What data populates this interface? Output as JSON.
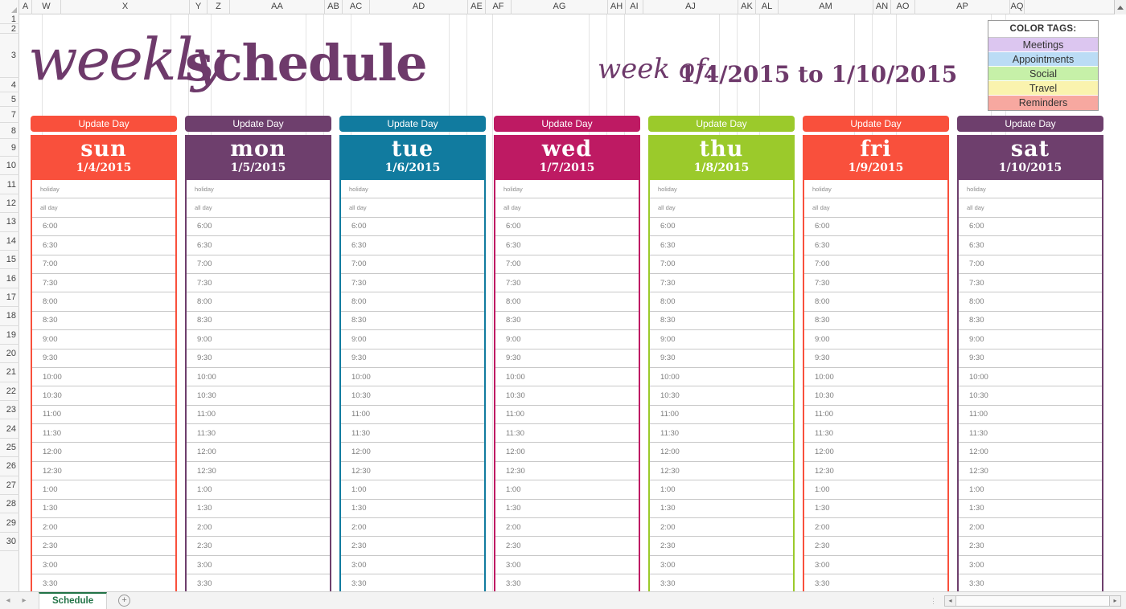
{
  "spreadsheet": {
    "column_headers": [
      "A",
      "W",
      "X",
      "Y",
      "Z",
      "AA",
      "AB",
      "AC",
      "AD",
      "AE",
      "AF",
      "AG",
      "AH",
      "AI",
      "AJ",
      "AK",
      "AL",
      "AM",
      "AN",
      "AO",
      "AP",
      "AQ"
    ],
    "row_headers": [
      "1",
      "2",
      "3",
      "4",
      "5",
      "7",
      "8",
      "9",
      "10",
      "11",
      "12",
      "13",
      "14",
      "15",
      "16",
      "17",
      "18",
      "19",
      "20",
      "21",
      "22",
      "23",
      "24",
      "25",
      "26",
      "27",
      "28",
      "29",
      "30"
    ],
    "sheet_tab": "Schedule",
    "add_sheet_label": "+",
    "nav_prev": "◂",
    "nav_next": "▸",
    "scroll_left": "◂",
    "scroll_right": "▸",
    "scroll_up": "▴"
  },
  "banner": {
    "title_script": "weekly",
    "title_bold": "schedule",
    "weekof_label": "week of:",
    "weekof_value": "1/4/2015 to 1/10/2015",
    "brand_purple": "#6E3A6B"
  },
  "legend": {
    "title": "COLOR TAGS:",
    "items": [
      {
        "label": "Meetings",
        "color": "#DCC6F0"
      },
      {
        "label": "Appointments",
        "color": "#BBDCF5"
      },
      {
        "label": "Social",
        "color": "#C6F0A8"
      },
      {
        "label": "Travel",
        "color": "#FAF3AE"
      },
      {
        "label": "Reminders",
        "color": "#F7A8A0"
      }
    ]
  },
  "schedule": {
    "update_day_label": "Update Day",
    "meta_rows": [
      "holiday",
      "all day"
    ],
    "time_slots": [
      "6:00",
      "6:30",
      "7:00",
      "7:30",
      "8:00",
      "8:30",
      "9:00",
      "9:30",
      "10:00",
      "10:30",
      "11:00",
      "11:30",
      "12:00",
      "12:30",
      "1:00",
      "1:30",
      "2:00",
      "2:30",
      "3:00",
      "3:30"
    ],
    "days": [
      {
        "name": "sun",
        "date": "1/4/2015",
        "color": "#F9503C"
      },
      {
        "name": "mon",
        "date": "1/5/2015",
        "color": "#6E3F6D"
      },
      {
        "name": "tue",
        "date": "1/6/2015",
        "color": "#117B9F"
      },
      {
        "name": "wed",
        "date": "1/7/2015",
        "color": "#BE1A63"
      },
      {
        "name": "thu",
        "date": "1/8/2015",
        "color": "#9BCA2B"
      },
      {
        "name": "fri",
        "date": "1/9/2015",
        "color": "#F9503C"
      },
      {
        "name": "sat",
        "date": "1/10/2015",
        "color": "#6E3F6D"
      }
    ]
  }
}
